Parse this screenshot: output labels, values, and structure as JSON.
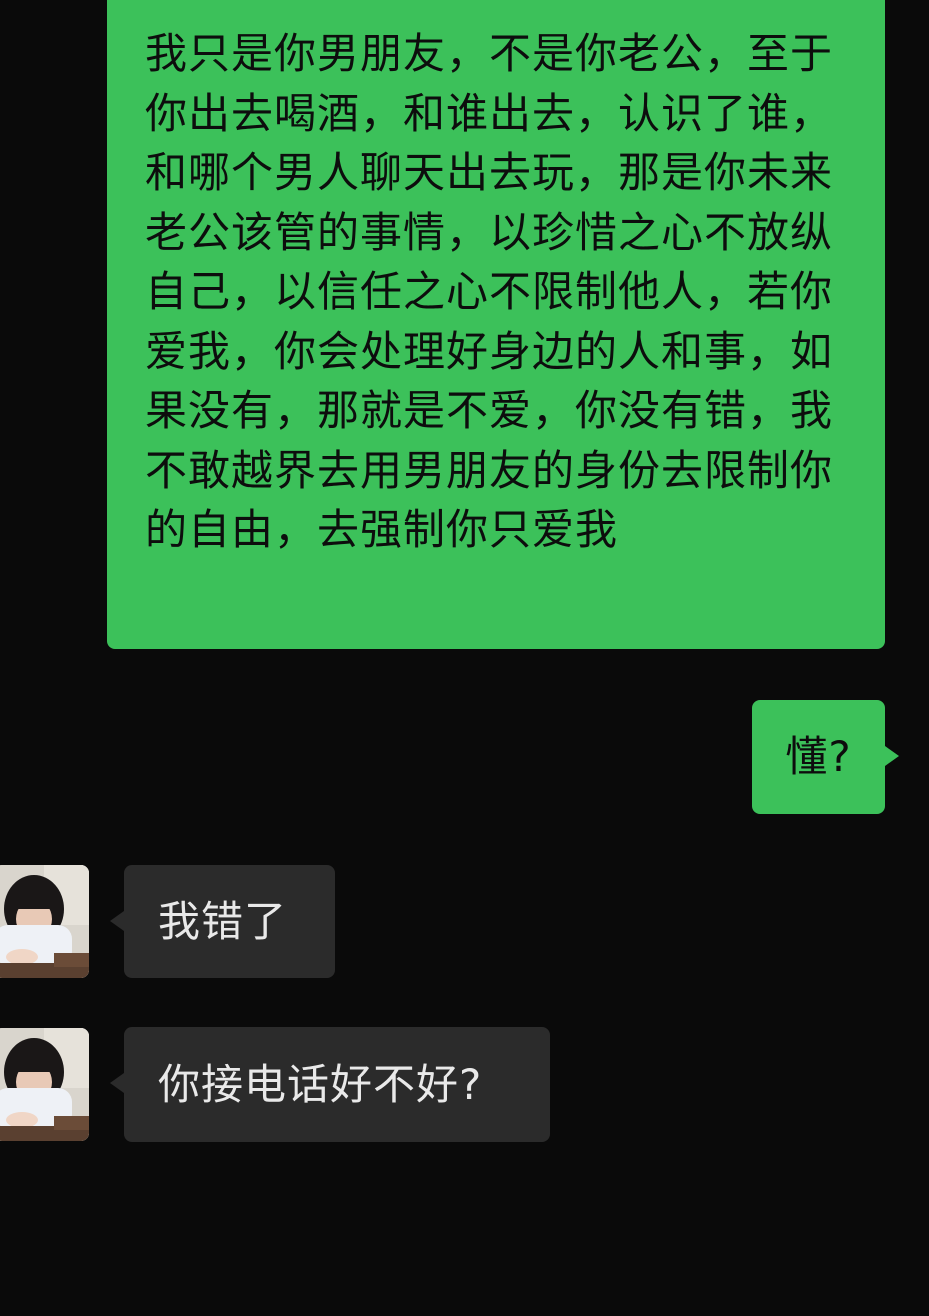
{
  "messages": [
    {
      "sender": "self",
      "text": "我只是你男朋友，不是你老公，至于你出去喝酒，和谁出去，认识了谁，和哪个男人聊天出去玩，那是你未来老公该管的事情，以珍惜之心不放纵自己，以信任之心不限制他人，若你爱我，你会处理好身边的人和事，如果没有，那就是不爱，你没有错，我不敢越界去用男朋友的身份去限制你的自由，去强制你只爱我"
    },
    {
      "sender": "self",
      "text": "懂?"
    },
    {
      "sender": "other",
      "text": "我错了"
    },
    {
      "sender": "other",
      "text": "你接电话好不好?"
    }
  ],
  "colors": {
    "background": "#0a0a0a",
    "outgoing_bubble": "#3cc15a",
    "incoming_bubble": "#2b2b2b",
    "incoming_text": "#e9e9e9",
    "outgoing_text": "#0d0d0d"
  },
  "icons": {
    "contact_avatar": "contact-avatar-photo"
  }
}
